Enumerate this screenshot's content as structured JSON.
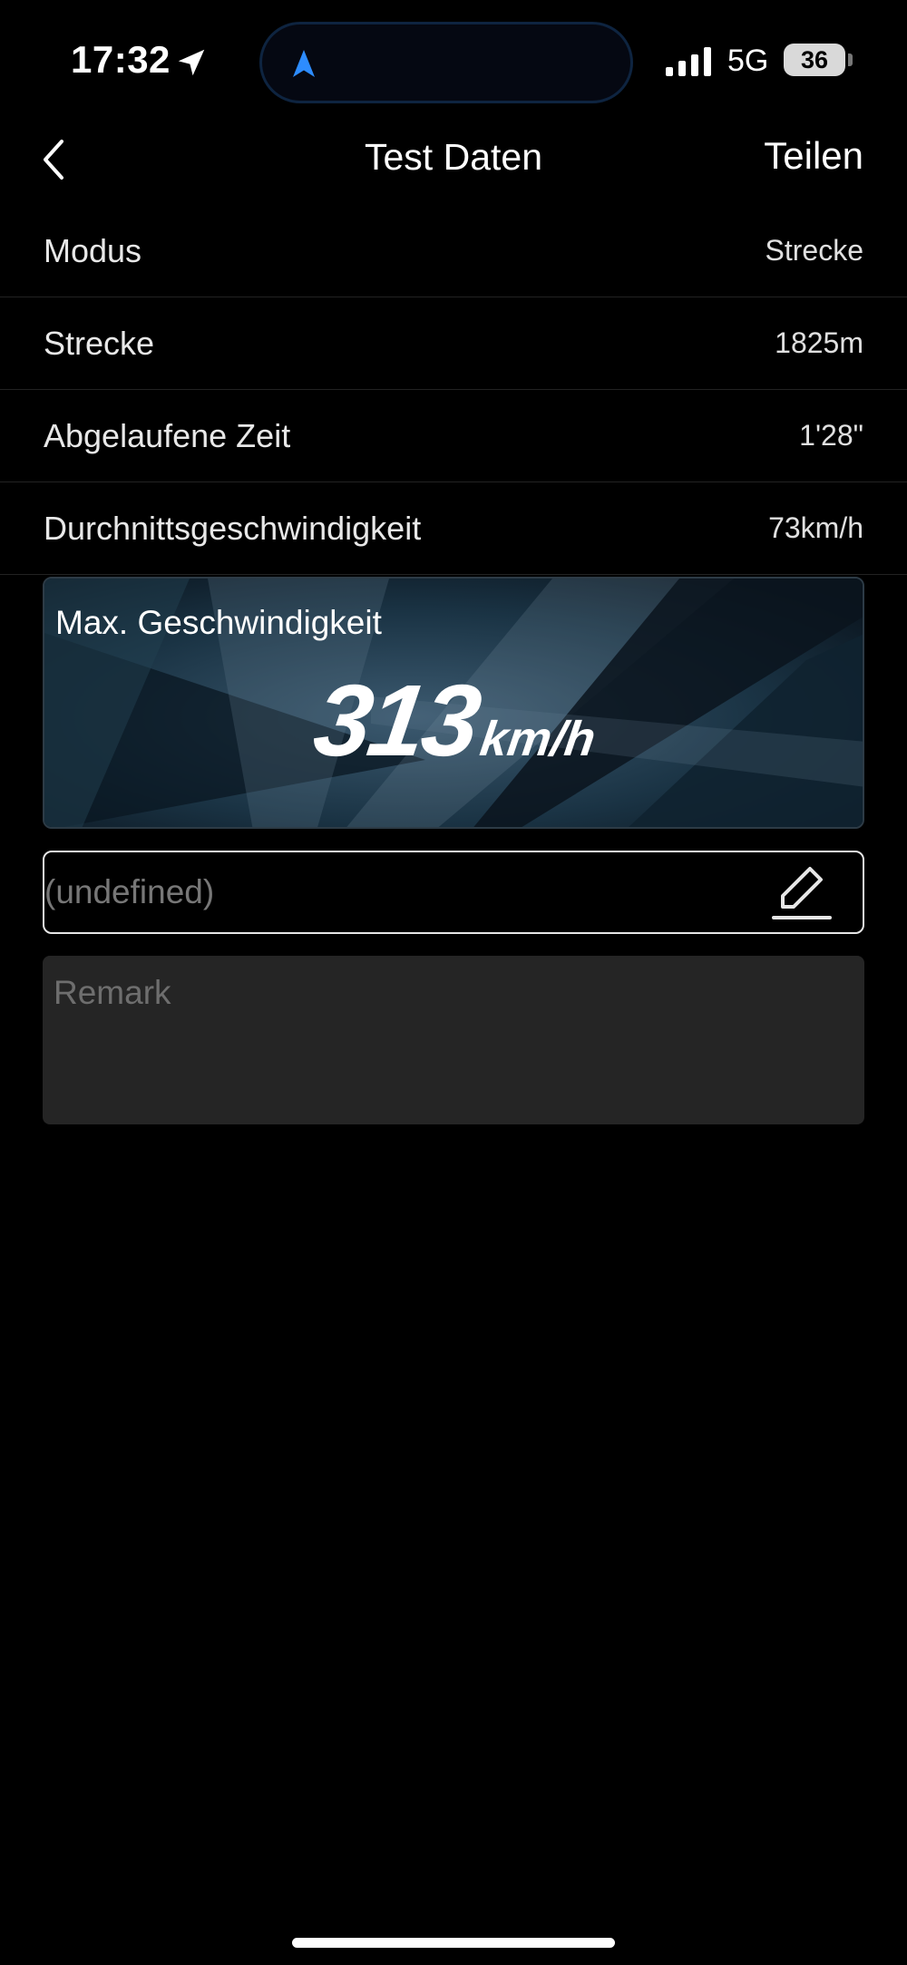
{
  "status_bar": {
    "time": "17:32",
    "network": "5G",
    "battery": "36",
    "icons": [
      "location-arrow-icon",
      "navigation-icon",
      "signal-icon",
      "battery-icon"
    ],
    "accent": "#2d8cff"
  },
  "nav": {
    "back_icon": "chevron-left-icon",
    "title": "Test Daten",
    "share_label": "Teilen"
  },
  "rows": [
    {
      "label": "Modus",
      "value": "Strecke"
    },
    {
      "label": "Strecke",
      "value": "1825m"
    },
    {
      "label": "Abgelaufene Zeit",
      "value": "1'28\""
    },
    {
      "label": "Durchnittsgeschwindigkeit",
      "value": "73km/h"
    }
  ],
  "max_speed": {
    "label": "Max. Geschwindigkeit",
    "value": "313",
    "unit": "km/h"
  },
  "name_field": {
    "value": "(undefined)",
    "edit_icon": "pencil-edit-icon"
  },
  "remark": {
    "placeholder": "Remark"
  }
}
